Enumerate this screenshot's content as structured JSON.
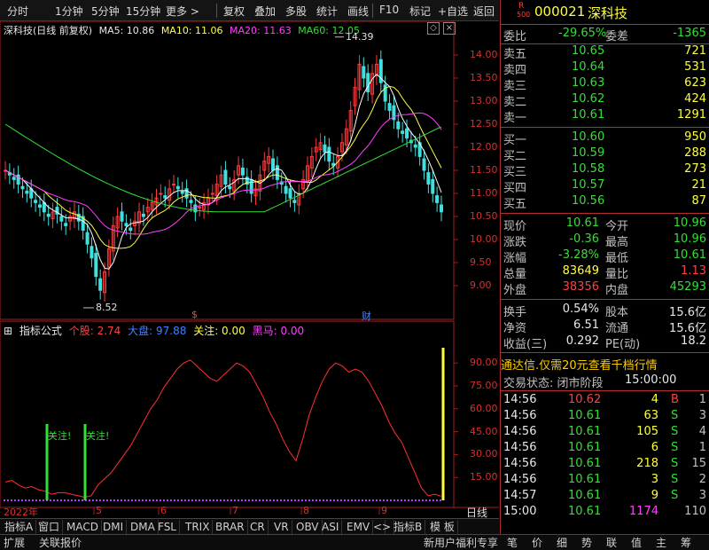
{
  "toolbar": {
    "left_items": [
      "分时",
      "1分钟",
      "5分钟",
      "15分钟",
      "更多 >"
    ],
    "right_items": [
      "复权",
      "叠加",
      "多股",
      "统计",
      "画线",
      "F10",
      "标记",
      "+自选",
      "返回"
    ]
  },
  "main_panel": {
    "stock_title": "深科技(日线 前复权)",
    "ma5": "MA5: 10.86",
    "ma10": "MA10: 11.06",
    "ma20": "MA20: 11.63",
    "ma60": "MA60: 12.05",
    "high_label": "14.39",
    "low_label": "8.52",
    "price_ticks": [
      "14.00",
      "13.50",
      "13.00",
      "12.50",
      "12.00",
      "11.50",
      "11.00",
      "10.50",
      "10.00",
      "9.50",
      "9.00"
    ],
    "marker_s": "$",
    "marker_cai": "财",
    "colors": {
      "up": "#ff3a3a",
      "down": "#40e0e0",
      "ma5": "#ffffff",
      "ma10": "#ffff40",
      "ma20": "#ff40ff",
      "ma60": "#33e033"
    }
  },
  "sub_panel": {
    "title": "指标公式",
    "individual": "个股: 2.74",
    "market": "大盘: 97.88",
    "follow": "关注: 0.00",
    "dark_horse": "黑马: 0.00",
    "ticks": [
      "90.00",
      "75.00",
      "60.00",
      "45.00",
      "30.00",
      "15.00"
    ],
    "follow_mark": "关注!"
  },
  "x_axis": {
    "labels": [
      "2022年",
      "5",
      "6",
      "7",
      "8",
      "9"
    ],
    "period": "日线"
  },
  "chart_data": {
    "type": "line",
    "title": "指标公式",
    "series": [
      {
        "name": "个股",
        "values": [
          12,
          13,
          10,
          8,
          9,
          7,
          6,
          4,
          5,
          5,
          4,
          3,
          2,
          3,
          10,
          14,
          18,
          24,
          30,
          36,
          44,
          52,
          60,
          66,
          74,
          80,
          86,
          90,
          92,
          88,
          84,
          80,
          78,
          82,
          86,
          90,
          88,
          84,
          76,
          68,
          58,
          50,
          40,
          32,
          26,
          40,
          56,
          68,
          78,
          86,
          90,
          88,
          84,
          86,
          84,
          78,
          70,
          62,
          52,
          44,
          38,
          28,
          18,
          8,
          3,
          4,
          2.74
        ]
      }
    ],
    "ylim": [
      0,
      100
    ]
  },
  "quote": {
    "code": "000021",
    "name": "深科技",
    "badge_r": "R",
    "badge_num": "500",
    "weibi_label": "委比",
    "weibi": "-29.65%",
    "weicha_label": "委差",
    "weicha": "-1365",
    "asks": [
      {
        "label": "卖五",
        "price": "10.65",
        "vol": "721"
      },
      {
        "label": "卖四",
        "price": "10.64",
        "vol": "531"
      },
      {
        "label": "卖三",
        "price": "10.63",
        "vol": "623"
      },
      {
        "label": "卖二",
        "price": "10.62",
        "vol": "424"
      },
      {
        "label": "卖一",
        "price": "10.61",
        "vol": "1291"
      }
    ],
    "bids": [
      {
        "label": "买一",
        "price": "10.60",
        "vol": "950"
      },
      {
        "label": "买二",
        "price": "10.59",
        "vol": "288"
      },
      {
        "label": "买三",
        "price": "10.58",
        "vol": "273"
      },
      {
        "label": "买四",
        "price": "10.57",
        "vol": "21"
      },
      {
        "label": "买五",
        "price": "10.56",
        "vol": "87"
      }
    ],
    "stats": [
      {
        "l1": "现价",
        "v1": "10.61",
        "c1": "green",
        "l2": "今开",
        "v2": "10.96",
        "c2": "green"
      },
      {
        "l1": "涨跌",
        "v1": "-0.36",
        "c1": "green",
        "l2": "最高",
        "v2": "10.96",
        "c2": "green"
      },
      {
        "l1": "涨幅",
        "v1": "-3.28%",
        "c1": "green",
        "l2": "最低",
        "v2": "10.61",
        "c2": "green"
      },
      {
        "l1": "总量",
        "v1": "83649",
        "c1": "yellow",
        "l2": "量比",
        "v2": "1.13",
        "c2": "red"
      },
      {
        "l1": "外盘",
        "v1": "38356",
        "c1": "red",
        "l2": "内盘",
        "v2": "45293",
        "c2": "green"
      }
    ],
    "fin": [
      {
        "l1": "换手",
        "v1": "0.54%",
        "l2": "股本",
        "v2": "15.6亿"
      },
      {
        "l1": "净资",
        "v1": "6.51",
        "l2": "流通",
        "v2": "15.6亿"
      },
      {
        "l1": "收益(三)",
        "v1": "0.292",
        "l2": "PE(动)",
        "v2": "18.2"
      }
    ],
    "promo": "通达信.仅需20元查看千档行情",
    "trade_status": "交易状态: 闭市阶段",
    "trade_time": "15:00:00",
    "ticks": [
      {
        "t": "14:56",
        "p": "10.62",
        "v": "4",
        "bs": "B",
        "n": "1",
        "pc": "red",
        "vc": "yellow",
        "bsc": "red"
      },
      {
        "t": "14:56",
        "p": "10.61",
        "v": "63",
        "bs": "S",
        "n": "3",
        "pc": "green",
        "vc": "yellow",
        "bsc": "green"
      },
      {
        "t": "14:56",
        "p": "10.61",
        "v": "105",
        "bs": "S",
        "n": "4",
        "pc": "green",
        "vc": "yellow",
        "bsc": "green"
      },
      {
        "t": "14:56",
        "p": "10.61",
        "v": "6",
        "bs": "S",
        "n": "1",
        "pc": "green",
        "vc": "yellow",
        "bsc": "green"
      },
      {
        "t": "14:56",
        "p": "10.61",
        "v": "218",
        "bs": "S",
        "n": "15",
        "pc": "green",
        "vc": "yellow",
        "bsc": "green"
      },
      {
        "t": "14:56",
        "p": "10.61",
        "v": "3",
        "bs": "S",
        "n": "2",
        "pc": "green",
        "vc": "yellow",
        "bsc": "green"
      },
      {
        "t": "14:57",
        "p": "10.61",
        "v": "9",
        "bs": "S",
        "n": "3",
        "pc": "green",
        "vc": "yellow",
        "bsc": "green"
      },
      {
        "t": "15:00",
        "p": "10.61",
        "v": "1174",
        "bs": "",
        "n": "110",
        "pc": "green",
        "vc": "magenta",
        "bsc": "green"
      }
    ]
  },
  "tabs": [
    "指标A",
    "窗口",
    "MACD",
    "DMI",
    "DMA",
    "FSL",
    "TRIX",
    "BRAR",
    "CR",
    "VR",
    "OBV",
    "ASI",
    "EMV",
    "<",
    ">",
    "指标B",
    "模 板"
  ],
  "statusbar": {
    "left": [
      "扩展",
      "关联报价"
    ],
    "promo": "新用户福利专享",
    "right": [
      "笔",
      "价",
      "细",
      "势",
      "联",
      "值",
      "主",
      "筹"
    ]
  }
}
